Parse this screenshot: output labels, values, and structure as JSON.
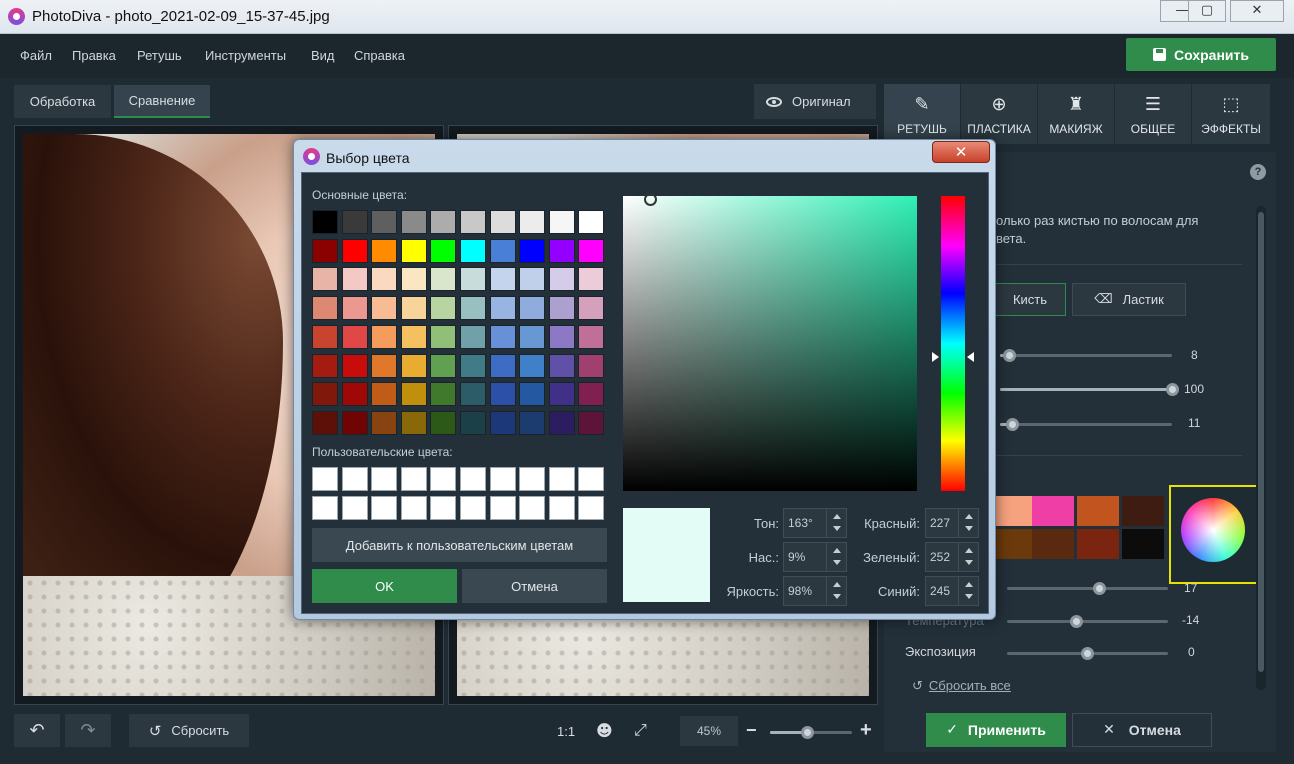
{
  "window": {
    "title": "PhotoDiva - photo_2021-02-09_15-37-45.jpg",
    "minimize_glyph": "—",
    "maximize_glyph": "▢",
    "close_glyph": "✕"
  },
  "menu": {
    "items": [
      "Файл",
      "Правка",
      "Ретушь",
      "Инструменты",
      "Вид",
      "Справка"
    ],
    "save_label": "Сохранить"
  },
  "tabs": {
    "processing": "Обработка",
    "comparison": "Сравнение",
    "original": "Оригинал"
  },
  "bottom_bar": {
    "reset_label": "Сбросить",
    "one_to_one": "1:1",
    "zoom_value": "45%",
    "zoom_minus": "−",
    "zoom_plus": "+",
    "zoom_level": 0.45
  },
  "right_panel": {
    "tabs": [
      {
        "label": "РЕТУШЬ",
        "icon": "brush-icon"
      },
      {
        "label": "ПЛАСТИКА",
        "icon": "globe-icon"
      },
      {
        "label": "МАКИЯЖ",
        "icon": "makeup-icon"
      },
      {
        "label": "ОБЩЕЕ",
        "icon": "sliders-icon"
      },
      {
        "label": "ЭФФЕКТЫ",
        "icon": "effects-icon"
      }
    ],
    "help": "?",
    "hint_line1": "олько раз кистью по волосам для",
    "hint_line2": "вета.",
    "brush_label": "Кисть",
    "eraser_label": "Ластик",
    "slider_values": [
      "8",
      "100",
      "11"
    ],
    "slider_levels": [
      0.05,
      1.0,
      0.07
    ],
    "swatch_colors": [
      "#f6a27e",
      "#ef3fa6",
      "#c2541f",
      "#3e1c12",
      "#6a3a0b",
      "#5a2a10",
      "#7a2510",
      "#0c0c0c"
    ],
    "adjust_values": [
      "17",
      "-14",
      "0"
    ],
    "adjust_labels": [
      "",
      "Температура",
      "Экспозиция"
    ],
    "reset_all": "Сбросить все",
    "apply_label": "Применить",
    "cancel_label": "Отмена"
  },
  "dialog": {
    "title": "Выбор цвета",
    "basic_colors_label": "Основные цвета:",
    "custom_colors_label": "Пользовательские цвета:",
    "basic_colors": [
      [
        "#000000",
        "#3a3a3a",
        "#5f5f5f",
        "#8a8a8a",
        "#acacac",
        "#c8c8c8",
        "#dcdcdc",
        "#ececec",
        "#f6f6f6",
        "#ffffff"
      ],
      [
        "#8b0000",
        "#ff0000",
        "#ff8c00",
        "#ffff00",
        "#00ff00",
        "#00ffff",
        "#4a7fd8",
        "#0000ff",
        "#9400ff",
        "#ff00ff"
      ],
      [
        "#e8b4a8",
        "#f4c8c4",
        "#fbd9c0",
        "#fbe6c4",
        "#d9e6cc",
        "#c8dcdc",
        "#c4d4ec",
        "#c0d0ea",
        "#d4cce8",
        "#ecccd8"
      ],
      [
        "#dc8872",
        "#ec9890",
        "#f8bc94",
        "#f8d49a",
        "#b8d4a0",
        "#98c0c0",
        "#98b4e0",
        "#90acdc",
        "#aca0d0",
        "#d4a0bc"
      ],
      [
        "#c8442e",
        "#e04848",
        "#f49c5c",
        "#f4c060",
        "#90c078",
        "#70a0a8",
        "#6890d8",
        "#6898d4",
        "#8c78c4",
        "#c07098"
      ],
      [
        "#a41c10",
        "#c80c0c",
        "#e0782c",
        "#e8ac30",
        "#60a050",
        "#407c88",
        "#3c6cc4",
        "#4080c8",
        "#6050a8",
        "#a04070"
      ],
      [
        "#80180c",
        "#a00808",
        "#c05c18",
        "#c0900c",
        "#40782c",
        "#2c5c68",
        "#2c50a8",
        "#2458a0",
        "#403088",
        "#802050"
      ],
      [
        "#5c1008",
        "#700404",
        "#884410",
        "#886808",
        "#2c5818",
        "#1c4048",
        "#1c3878",
        "#1c3c70",
        "#2c1c60",
        "#5c1438"
      ]
    ],
    "add_custom_label": "Добавить к пользовательским цветам",
    "ok_label": "OK",
    "cancel_label": "Отмена",
    "preview_color": "#e3fcf5",
    "hue_label": "Тон:",
    "hue_value": "163°",
    "sat_label": "Нас.:",
    "sat_value": "9%",
    "bright_label": "Яркость:",
    "bright_value": "98%",
    "red_label": "Красный:",
    "red_value": "227",
    "green_label": "Зеленый:",
    "green_value": "252",
    "blue_label": "Синий:",
    "blue_value": "245"
  },
  "colors": {
    "accent": "#2f8c4a",
    "panel_bg": "#23303a",
    "app_bg": "#1f2b33",
    "highlight": "#e8e200"
  }
}
